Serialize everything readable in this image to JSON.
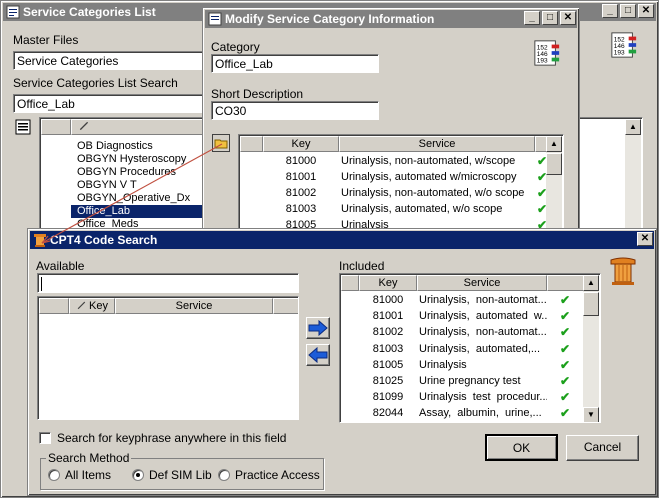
{
  "bg_window": {
    "title": "Service Categories List",
    "master_files_label": "Master Files",
    "master_files_value": "Service Categories",
    "search_label": "Service Categories List Search",
    "search_value": "Office_Lab",
    "items": [
      "OB Diagnostics",
      "OBGYN Hysteroscopy",
      "OBGYN Procedures",
      "OBGYN V T",
      "OBGYN_Operative_Dx",
      "Office_Lab",
      "Office_Meds"
    ],
    "selected_index": 5
  },
  "modify_window": {
    "title": "Modify Service Category Information",
    "category_label": "Category",
    "category_value": "Office_Lab",
    "short_desc_label": "Short Description",
    "short_desc_value": "CO30",
    "col_key": "Key",
    "col_service": "Service",
    "rows": [
      {
        "key": "81000",
        "service": "Urinalysis, non-automated, w/scope"
      },
      {
        "key": "81001",
        "service": "Urinalysis, automated w/microscopy"
      },
      {
        "key": "81002",
        "service": "Urinalysis, non-automated, w/o scope"
      },
      {
        "key": "81003",
        "service": "Urinalysis, automated, w/o scope"
      },
      {
        "key": "81005",
        "service": "Urinalysis"
      }
    ]
  },
  "cpt_window": {
    "title": "CPT4 Code Search",
    "available_label": "Available",
    "available_search": "",
    "col_key": "Key",
    "col_service": "Service",
    "included_label": "Included",
    "inc_col_key": "Key",
    "inc_col_service": "Service",
    "included_rows": [
      {
        "key": "81000",
        "service": "Urinalysis,  non-automat..."
      },
      {
        "key": "81001",
        "service": "Urinalysis,  automated  w..."
      },
      {
        "key": "81002",
        "service": "Urinalysis,  non-automat..."
      },
      {
        "key": "81003",
        "service": "Urinalysis,  automated,..."
      },
      {
        "key": "81005",
        "service": "Urinalysis"
      },
      {
        "key": "81025",
        "service": "Urine pregnancy test"
      },
      {
        "key": "81099",
        "service": "Urinalysis  test  procedur..."
      },
      {
        "key": "82044",
        "service": "Assay,  albumin,  urine,..."
      }
    ],
    "keyphrase_label": "Search for keyphrase anywhere in this field",
    "search_method_label": "Search Method",
    "radio_all": "All Items",
    "radio_def": "Def SIM Lib",
    "radio_practice": "Practice Access",
    "selected_method": "Def SIM Lib",
    "ok_label": "OK",
    "cancel_label": "Cancel"
  },
  "colors": {
    "title_active": "#0a246a",
    "title_inactive": "#808080",
    "check_green": "#1ca01c",
    "arrow_blue": "#1c5cd8"
  }
}
